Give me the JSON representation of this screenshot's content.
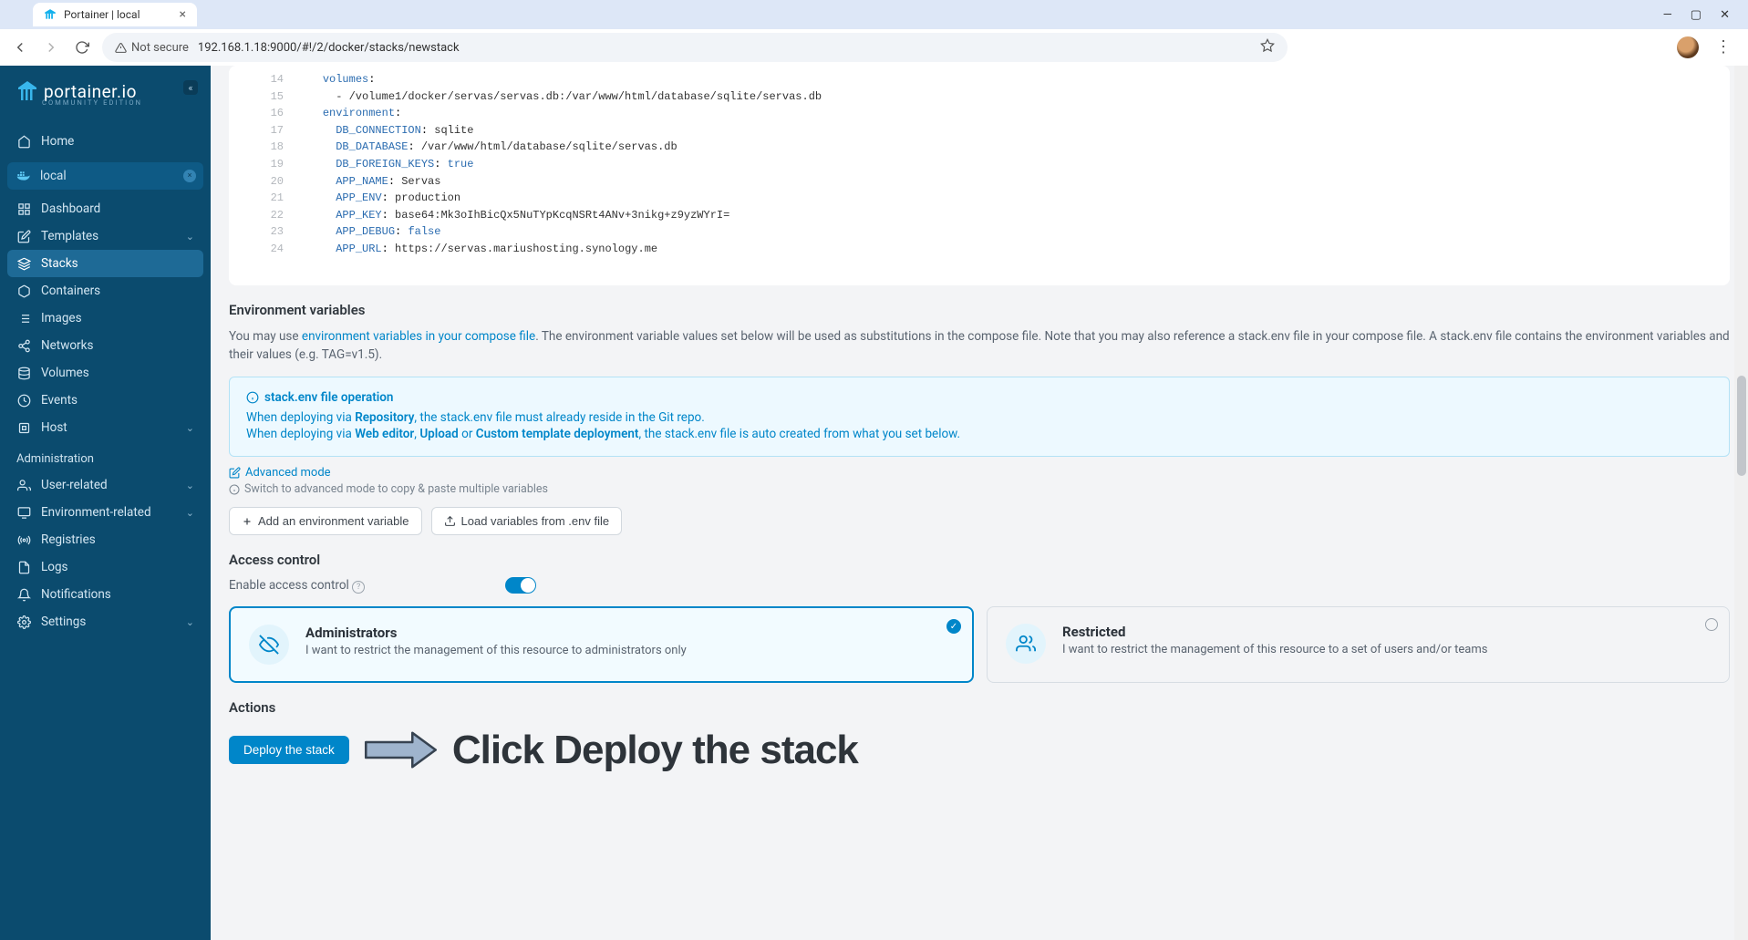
{
  "browser": {
    "tab_title": "Portainer | local",
    "url": "192.168.1.18:9000/#!/2/docker/stacks/newstack",
    "not_secure": "Not secure",
    "window": {
      "min": "—",
      "max": "▢",
      "close": "✕"
    }
  },
  "sidebar": {
    "brand": "portainer.io",
    "brand_sub": "COMMUNITY EDITION",
    "home": "Home",
    "env_name": "local",
    "nav": [
      {
        "label": "Dashboard"
      },
      {
        "label": "Templates",
        "chev": true
      },
      {
        "label": "Stacks",
        "active": true
      },
      {
        "label": "Containers"
      },
      {
        "label": "Images"
      },
      {
        "label": "Networks"
      },
      {
        "label": "Volumes"
      },
      {
        "label": "Events"
      },
      {
        "label": "Host",
        "chev": true
      }
    ],
    "admin_head": "Administration",
    "admin": [
      {
        "label": "User-related",
        "chev": true
      },
      {
        "label": "Environment-related",
        "chev": true
      },
      {
        "label": "Registries"
      },
      {
        "label": "Logs"
      },
      {
        "label": "Notifications"
      },
      {
        "label": "Settings",
        "chev": true
      }
    ]
  },
  "editor": {
    "lines": [
      {
        "n": 14,
        "indent": 4,
        "key": "volumes",
        "after": ":"
      },
      {
        "n": 15,
        "indent": 6,
        "raw": "- /volume1/docker/servas/servas.db:/var/www/html/database/sqlite/servas.db"
      },
      {
        "n": 16,
        "indent": 4,
        "key": "environment",
        "after": ":"
      },
      {
        "n": 17,
        "indent": 6,
        "key": "DB_CONNECTION",
        "val": "sqlite"
      },
      {
        "n": 18,
        "indent": 6,
        "key": "DB_DATABASE",
        "val": "/var/www/html/database/sqlite/servas.db"
      },
      {
        "n": 19,
        "indent": 6,
        "key": "DB_FOREIGN_KEYS",
        "bool": "true"
      },
      {
        "n": 20,
        "indent": 6,
        "key": "APP_NAME",
        "val": "Servas"
      },
      {
        "n": 21,
        "indent": 6,
        "key": "APP_ENV",
        "val": "production"
      },
      {
        "n": 22,
        "indent": 6,
        "key": "APP_KEY",
        "val": "base64:Mk3oIhBicQx5NuTYpKcqNSRt4ANv+3nikg+z9yzWYrI="
      },
      {
        "n": 23,
        "indent": 6,
        "key": "APP_DEBUG",
        "bool": "false"
      },
      {
        "n": 24,
        "indent": 6,
        "key": "APP_URL",
        "val": "https://servas.mariushosting.synology.me"
      }
    ]
  },
  "env": {
    "title": "Environment variables",
    "desc_pre": "You may use ",
    "desc_link": "environment variables in your compose file",
    "desc_post": ". The environment variable values set below will be used as substitutions in the compose file. Note that you may also reference a stack.env file in your compose file. A stack.env file contains the environment variables and their values (e.g. TAG=v1.5).",
    "info_head": "stack.env file operation",
    "info_l1a": "When deploying via ",
    "info_l1b": "Repository",
    "info_l1c": ", the stack.env file must already reside in the Git repo.",
    "info_l2a": "When deploying via ",
    "info_l2b": "Web editor",
    "info_l2c": ", ",
    "info_l2d": "Upload",
    "info_l2e": " or ",
    "info_l2f": "Custom template deployment",
    "info_l2g": ", the stack.env file is auto created from what you set below.",
    "adv_link": "Advanced mode",
    "adv_hint": "Switch to advanced mode to copy & paste multiple variables",
    "btn_add": "Add an environment variable",
    "btn_load": "Load variables from .env file"
  },
  "access": {
    "title": "Access control",
    "label": "Enable access control",
    "opt1_title": "Administrators",
    "opt1_desc": "I want to restrict the management of this resource to administrators only",
    "opt2_title": "Restricted",
    "opt2_desc": "I want to restrict the management of this resource to a set of users and/or teams"
  },
  "actions": {
    "title": "Actions",
    "deploy": "Deploy the stack",
    "callout": "Click Deploy the stack"
  }
}
